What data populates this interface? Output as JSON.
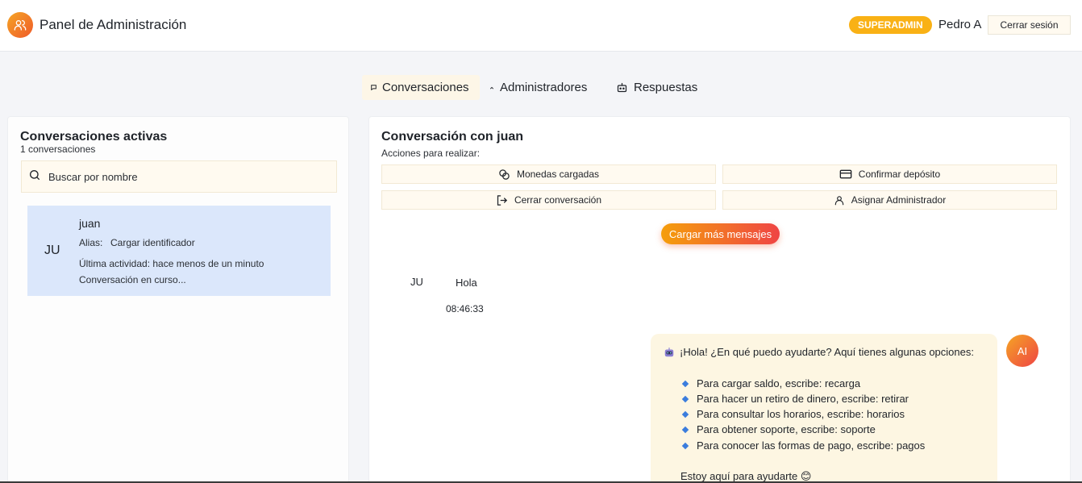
{
  "header": {
    "title": "Panel de Administración",
    "role_badge": "SUPERADMIN",
    "user_name": "Pedro A",
    "logout_label": "Cerrar sesión",
    "accent_color": "#f5a524",
    "badge_color": "#f9b115"
  },
  "tabs": [
    {
      "label": "Conversaciones",
      "icon": "chat-bubble-icon",
      "active": true
    },
    {
      "label": "Administradores",
      "icon": "chevron-up-icon",
      "active": false
    },
    {
      "label": "Respuestas",
      "icon": "robot-icon",
      "active": false
    }
  ],
  "sidebar": {
    "title": "Conversaciones activas",
    "count_text": "1 conversaciones",
    "search": {
      "placeholder": "Buscar por nombre",
      "value": "",
      "icon": "search-icon"
    },
    "conversations": [
      {
        "initials": "JU",
        "name": "juan",
        "alias_label": "Alias:",
        "alias_value": "Cargar identificador",
        "activity": "Última actividad: hace menos de un minuto",
        "status": "Conversación en curso...",
        "selected": true,
        "highlight_color": "#dbe7fb"
      }
    ]
  },
  "chat": {
    "title": "Conversación con juan",
    "actions_label": "Acciones para realizar:",
    "actions": [
      {
        "label": "Monedas cargadas",
        "icon": "coins-icon"
      },
      {
        "label": "Confirmar depósito",
        "icon": "credit-card-icon"
      },
      {
        "label": "Cerrar conversación",
        "icon": "logout-icon"
      },
      {
        "label": "Asignar Administrador",
        "icon": "user-icon"
      }
    ],
    "load_more_label": "Cargar más mensajes",
    "messages": [
      {
        "sender_initials": "JU",
        "text": "Hola",
        "time": "08:46:33"
      }
    ],
    "bot_message": {
      "avatar_label": "AI",
      "intro": "¡Hola! ¿En qué puedo ayudarte? Aquí tienes algunas opciones:",
      "intro_icon": "robot-emoji-icon",
      "options": [
        "Para cargar saldo, escribe: recarga",
        "Para hacer un retiro de dinero, escribe: retirar",
        "Para consultar los horarios, escribe: horarios",
        "Para obtener soporte, escribe: soporte",
        "Para conocer las formas de pago, escribe: pagos"
      ],
      "outro": "Estoy aquí para ayudarte 😊",
      "bubble_color": "#fdf6e2"
    }
  }
}
